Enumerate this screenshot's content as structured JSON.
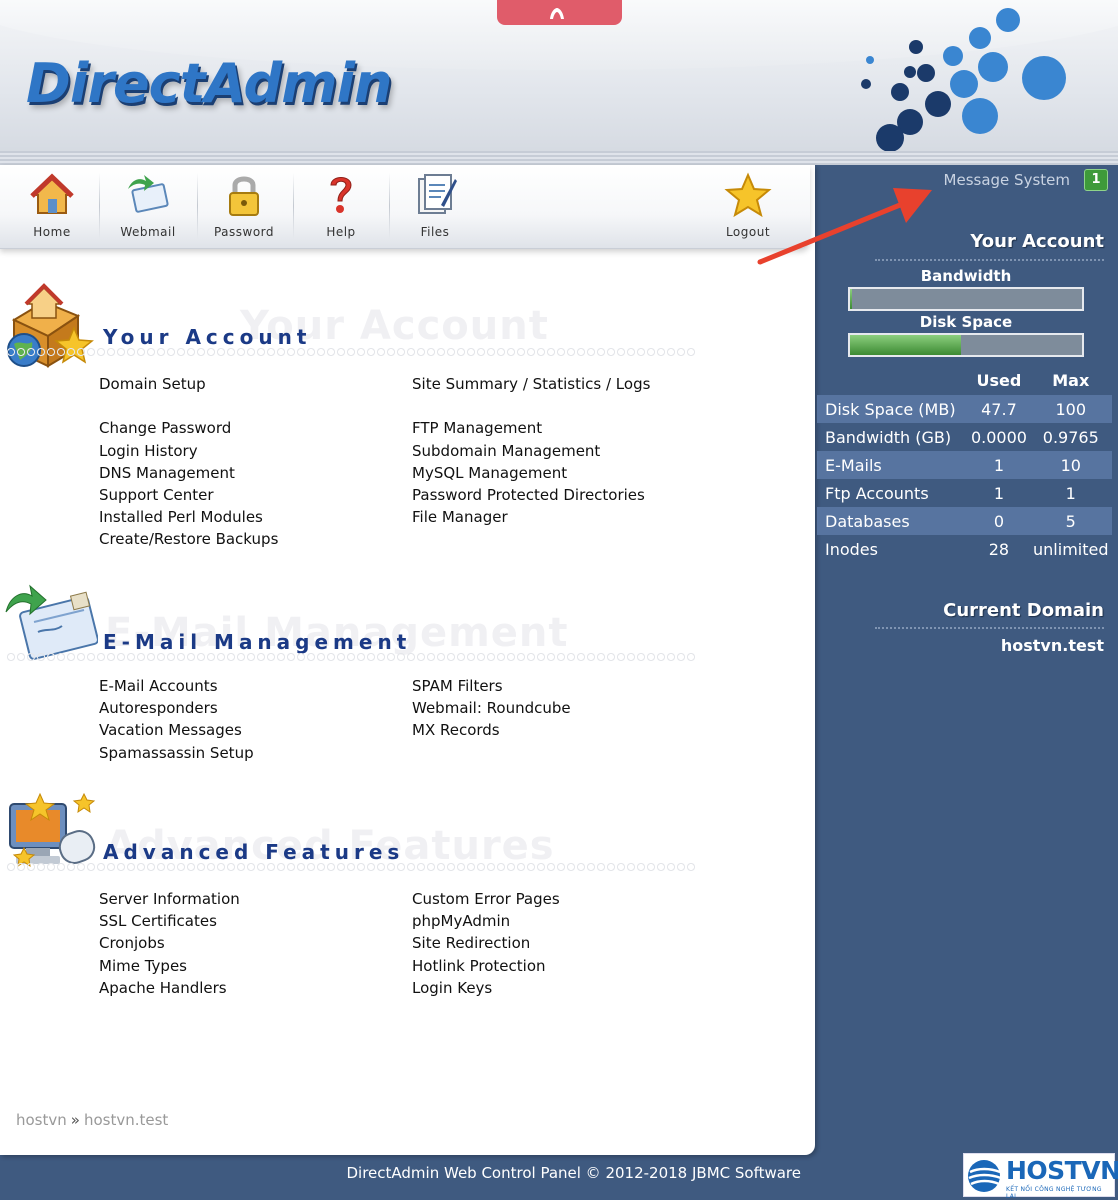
{
  "header": {
    "logo": "DirectAdmin"
  },
  "toolbar": {
    "items": [
      {
        "label": "Home"
      },
      {
        "label": "Webmail"
      },
      {
        "label": "Password"
      },
      {
        "label": "Help"
      },
      {
        "label": "Files"
      },
      {
        "label": "Logout"
      }
    ]
  },
  "sidebar": {
    "message_label": "Message System",
    "message_count": "1",
    "account_title": "Your Account",
    "bandwidth_label": "Bandwidth",
    "bandwidth_fraction": 0.0,
    "disk_label": "Disk Space",
    "disk_fraction": 0.477,
    "col_used": "Used",
    "col_max": "Max",
    "rows": [
      {
        "name": "Disk Space (MB)",
        "used": "47.7",
        "max": "100"
      },
      {
        "name": "Bandwidth (GB)",
        "used": "0.0000",
        "max": "0.9765"
      },
      {
        "name": "E-Mails",
        "used": "1",
        "max": "10"
      },
      {
        "name": "Ftp Accounts",
        "used": "1",
        "max": "1"
      },
      {
        "name": "Databases",
        "used": "0",
        "max": "5"
      },
      {
        "name": "Inodes",
        "used": "28",
        "max": "unlimited"
      }
    ],
    "domain_title": "Current Domain",
    "domain": "hostvn.test"
  },
  "sections": {
    "account": {
      "title": "Your Account",
      "left": [
        "Domain Setup",
        "",
        "Change Password",
        "Login History",
        "DNS Management",
        "Support Center",
        "Installed Perl Modules",
        "Create/Restore Backups"
      ],
      "right": [
        "Site Summary / Statistics / Logs",
        "",
        "FTP Management",
        "Subdomain Management",
        "MySQL Management",
        "Password Protected Directories",
        "File Manager"
      ]
    },
    "email": {
      "title": "E-Mail Management",
      "left": [
        "E-Mail Accounts",
        "Autoresponders",
        "Vacation Messages",
        "Spamassassin Setup"
      ],
      "right": [
        "SPAM Filters",
        "Webmail: Roundcube",
        "MX Records"
      ]
    },
    "advanced": {
      "title": "Advanced Features",
      "left": [
        "Server Information",
        "SSL Certificates",
        "Cronjobs",
        "Mime Types",
        "Apache Handlers"
      ],
      "right": [
        "Custom Error Pages",
        "phpMyAdmin",
        "Site Redirection",
        "Hotlink Protection",
        "Login Keys"
      ]
    }
  },
  "breadcrumb": {
    "user": "hostvn",
    "sep": "»",
    "domain": "hostvn.test"
  },
  "footer": {
    "text": "DirectAdmin Web Control Panel © 2012-2018 JBMC Software"
  },
  "brand": {
    "name": "HOSTVN",
    "tagline": "KẾT NỐI CÔNG NGHỆ TƯƠNG LAI"
  },
  "colors": {
    "accent": "#2f76c6",
    "sidebar": "#3f5a80",
    "badge": "#3e9a3a",
    "arrow": "#e8412d"
  }
}
